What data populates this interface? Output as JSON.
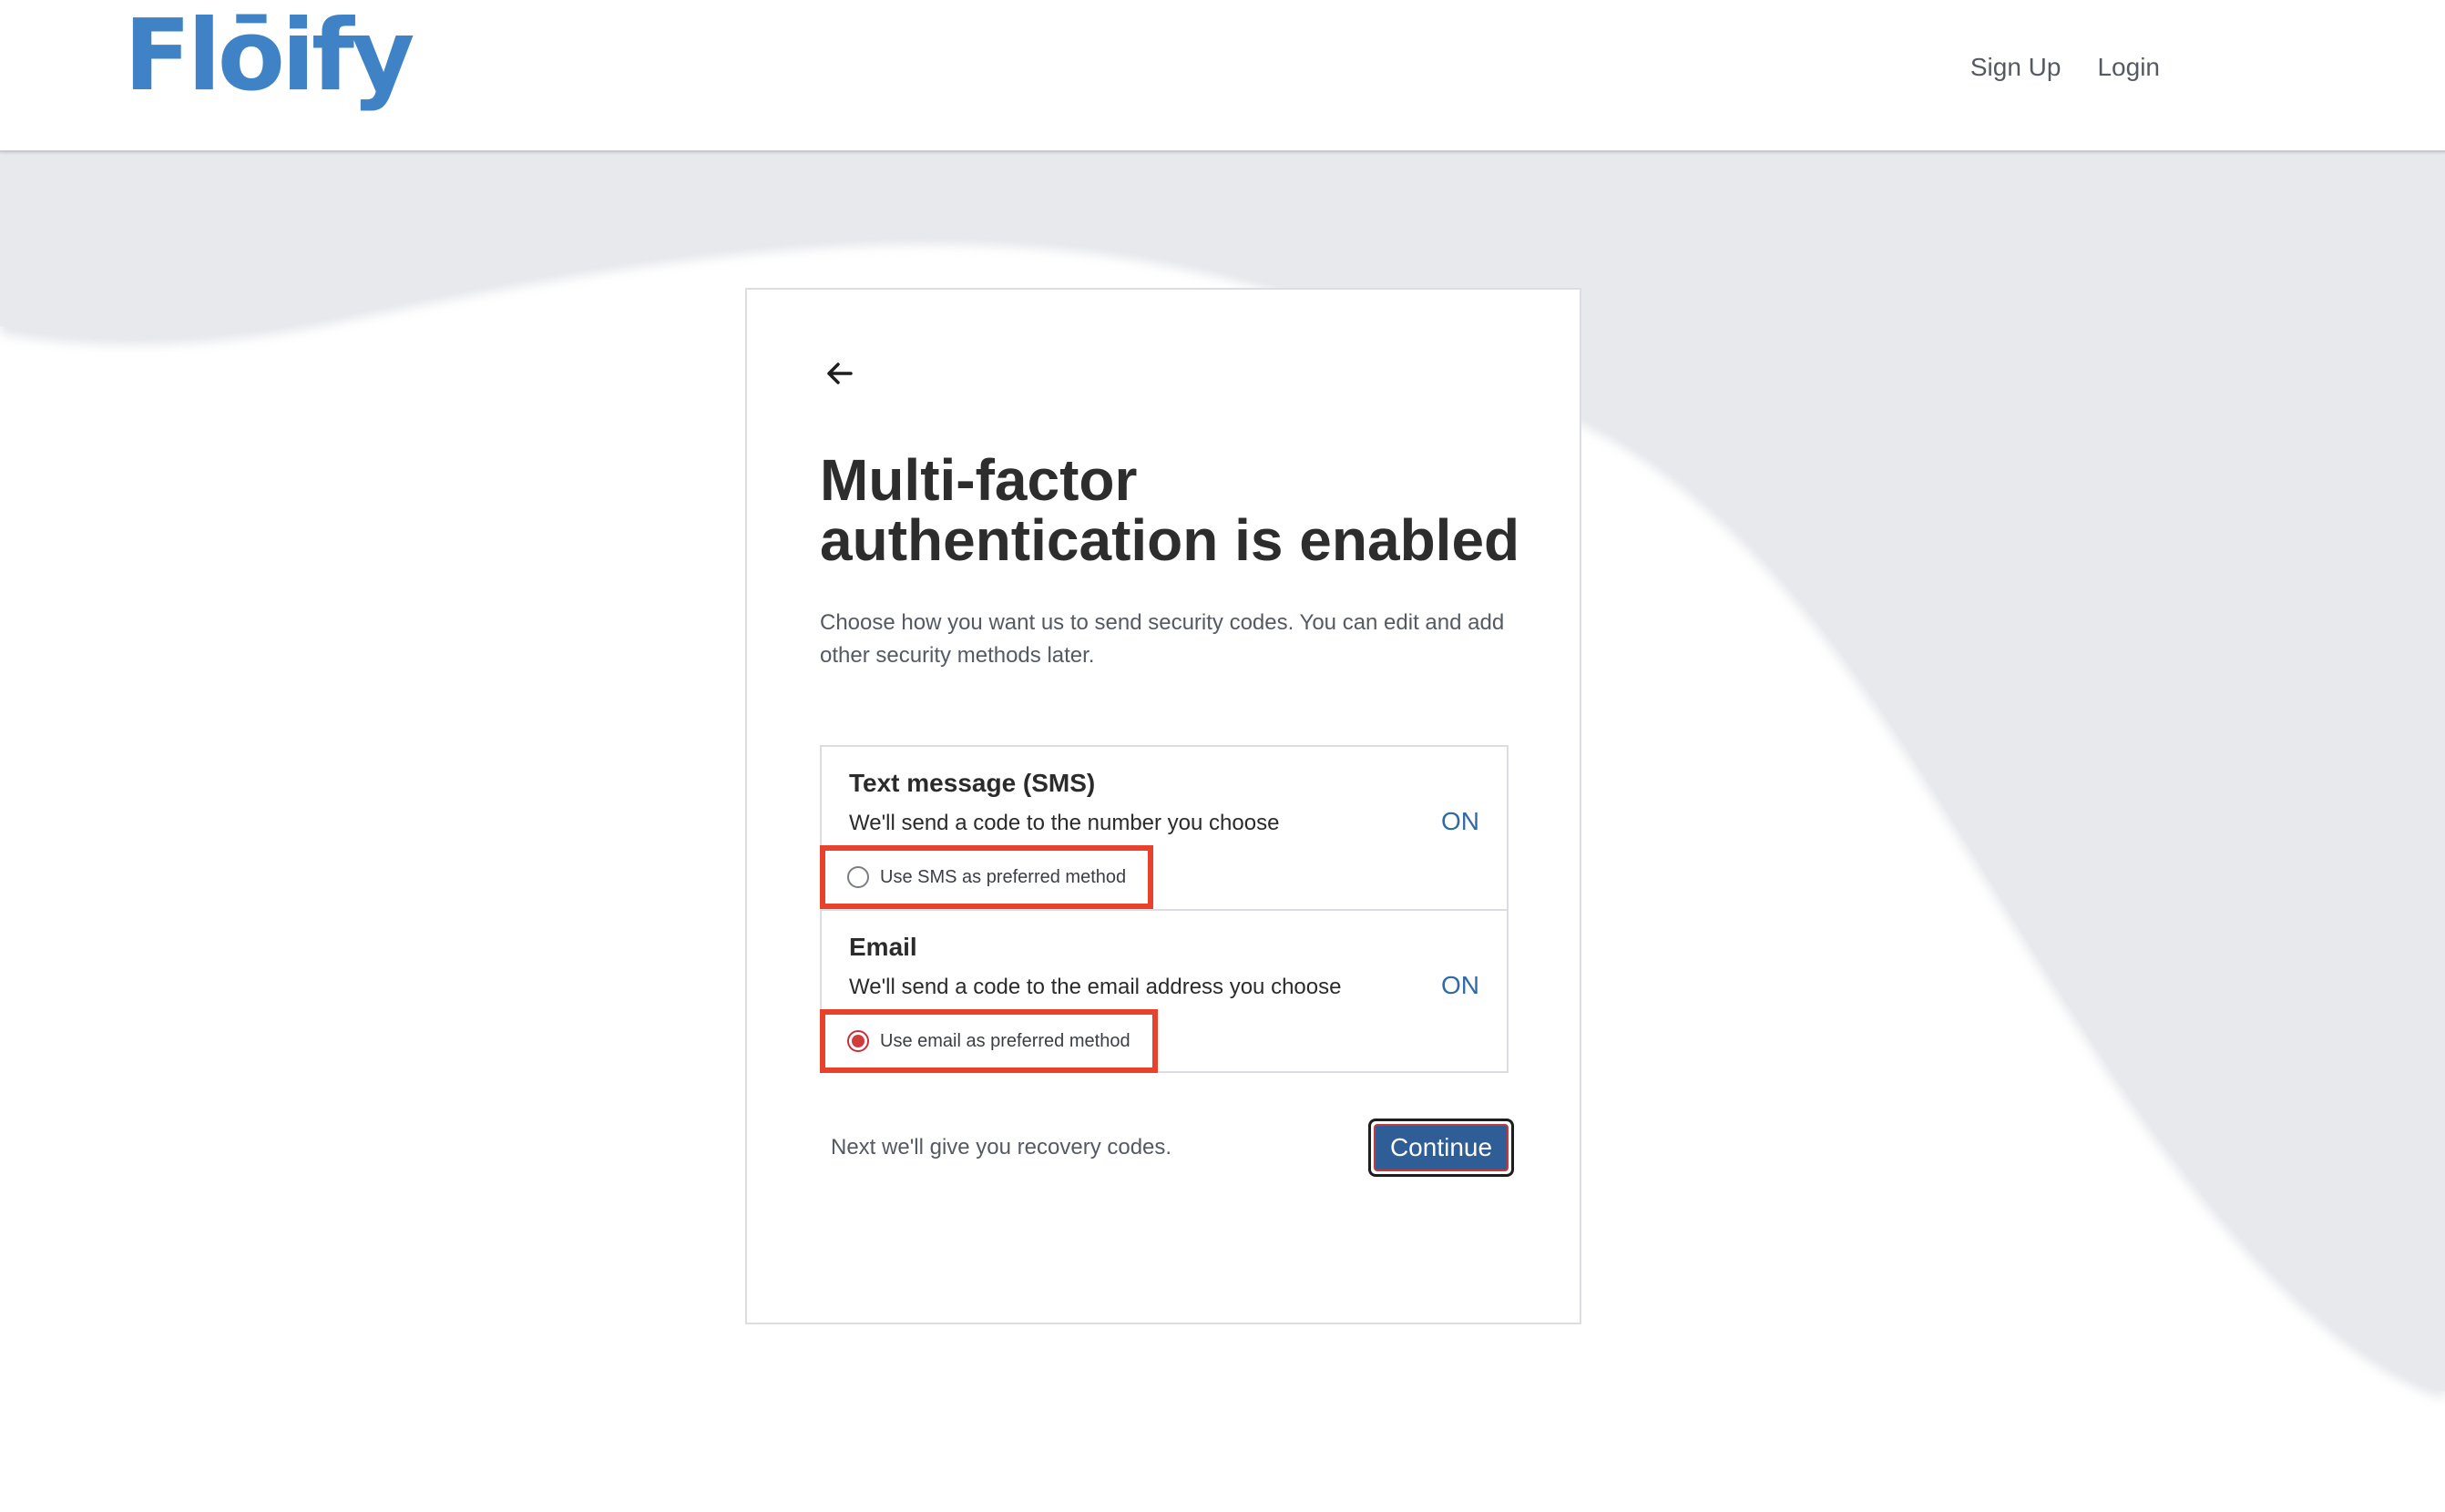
{
  "header": {
    "logo_text": "Flōify",
    "nav": {
      "signup_label": "Sign Up",
      "login_label": "Login"
    }
  },
  "card": {
    "back_icon": "arrow-left-icon",
    "title": "Multi-factor authentication is enabled",
    "subtitle": "Choose how you want us to send security codes. You can edit and add other security methods later.",
    "options": [
      {
        "title": "Text message (SMS)",
        "description": "We'll send a code to the number you choose",
        "status": "ON",
        "preferred_label": "Use SMS as preferred method",
        "preferred_selected": false
      },
      {
        "title": "Email",
        "description": "We'll send a code to the email address you choose",
        "status": "ON",
        "preferred_label": "Use email as preferred method",
        "preferred_selected": true
      }
    ],
    "footer_note": "Next we'll give you recovery codes.",
    "continue_label": "Continue"
  },
  "colors": {
    "brand_blue": "#3f83c6",
    "status_blue": "#2f6aa7",
    "button_blue": "#2f5d95",
    "highlight_red": "#e8412c",
    "background_gray": "#e8e9ed"
  }
}
